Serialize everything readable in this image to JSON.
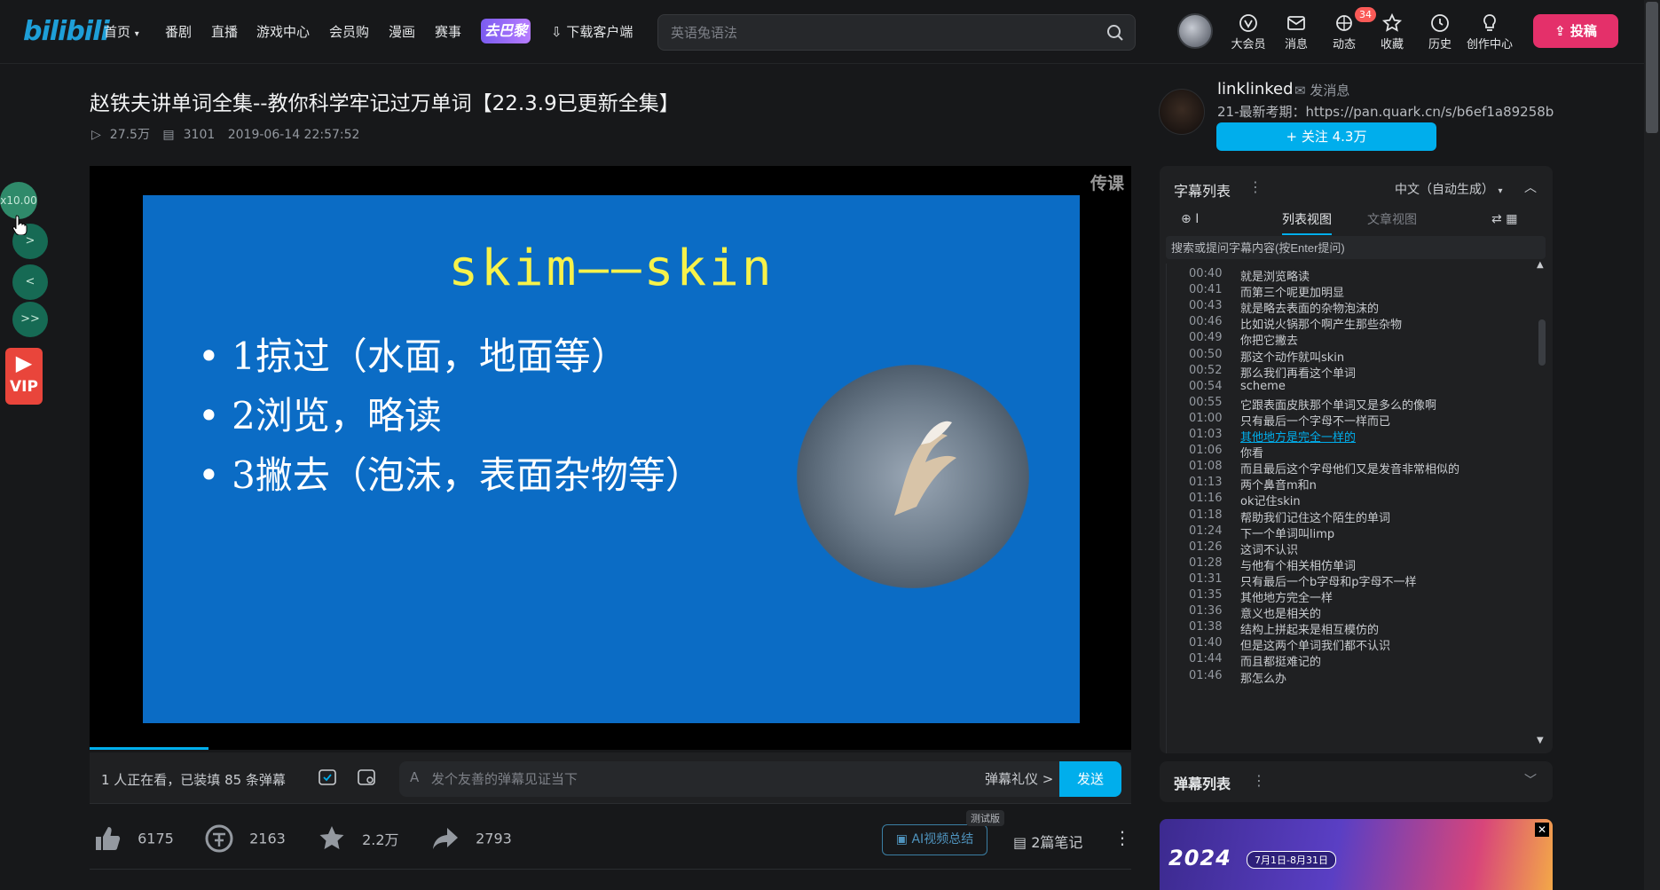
{
  "nav": {
    "logo": "bilibili",
    "items": [
      "首页",
      "番剧",
      "直播",
      "游戏中心",
      "会员购",
      "漫画",
      "赛事"
    ],
    "game_badge": "去巴黎",
    "download_client": "下载客户端",
    "search_placeholder": "英语兔语法",
    "right_items": [
      "大会员",
      "消息",
      "动态",
      "收藏",
      "历史",
      "创作中心"
    ],
    "dynamic_badge": "34",
    "upload_label": "投稿"
  },
  "video": {
    "title": "赵铁夫讲单词全集--教你科学牢记过万单词【22.3.9已更新全集】",
    "views": "27.5万",
    "danmaku_count": "3101",
    "date": "2019-06-14 22:57:52"
  },
  "slide": {
    "title": "skim——skin",
    "bullets": [
      "1掠过（水面，地面等）",
      "2浏览，略读",
      "3撇去（泡沫，表面杂物等）"
    ],
    "watermark": "传课"
  },
  "danmaku_bar": {
    "viewer_text": "1 人正在看，已装填 85 条弹幕",
    "input_placeholder": "发个友善的弹幕见证当下",
    "etiquette": "弹幕礼仪 >",
    "send": "发送"
  },
  "actions": {
    "like": "6175",
    "coin": "2163",
    "favorite": "2.2万",
    "share": "2793",
    "ai_summary": "AI视频总结",
    "ai_beta": "测试版",
    "notes": "2篇笔记",
    "more": "⋮"
  },
  "left_float": {
    "speed": "x10.00",
    "btn_forward": ">",
    "btn_back": "<",
    "btn_fast": ">>",
    "vip": "VIP"
  },
  "uploader": {
    "name": "linklinked",
    "send_message": "发消息",
    "desc": "21-最新考期：https://pan.quark.cn/s/b6ef1a89258b",
    "follow": "+ 关注 4.3万"
  },
  "subtitle_panel": {
    "title": "字幕列表",
    "kebab": "⋮",
    "language": "中文（自动生成）",
    "tab_list": "列表视图",
    "tab_article": "文章视图",
    "search_placeholder": "搜索或提问字幕内容(按Enter提问)",
    "active_index": 10,
    "rows": [
      {
        "time": "00:40",
        "text": "就是浏览略读"
      },
      {
        "time": "00:41",
        "text": "而第三个呢更加明显"
      },
      {
        "time": "00:43",
        "text": "就是略去表面的杂物泡沫的"
      },
      {
        "time": "00:46",
        "text": "比如说火锅那个啊产生那些杂物"
      },
      {
        "time": "00:49",
        "text": "你把它撇去"
      },
      {
        "time": "00:50",
        "text": "那这个动作就叫skin"
      },
      {
        "time": "00:52",
        "text": "那么我们再看这个单词"
      },
      {
        "time": "00:54",
        "text": "scheme"
      },
      {
        "time": "00:55",
        "text": "它跟表面皮肤那个单词又是多么的像啊"
      },
      {
        "time": "01:00",
        "text": "只有最后一个字母不一样而已"
      },
      {
        "time": "01:03",
        "text": "其他地方是完全一样的"
      },
      {
        "time": "01:06",
        "text": "你看"
      },
      {
        "time": "01:08",
        "text": "而且最后这个字母他们又是发音非常相似的"
      },
      {
        "time": "01:13",
        "text": "两个鼻音m和n"
      },
      {
        "time": "01:16",
        "text": "ok记住skin"
      },
      {
        "time": "01:18",
        "text": "帮助我们记住这个陌生的单词"
      },
      {
        "time": "01:24",
        "text": "下一个单词叫limp"
      },
      {
        "time": "01:26",
        "text": "这词不认识"
      },
      {
        "time": "01:28",
        "text": "与他有个相关相仿单词"
      },
      {
        "time": "01:31",
        "text": "只有最后一个b字母和p字母不一样"
      },
      {
        "time": "01:35",
        "text": "其他地方完全一样"
      },
      {
        "time": "01:36",
        "text": "意义也是相关的"
      },
      {
        "time": "01:38",
        "text": "结构上拼起来是相互模仿的"
      },
      {
        "time": "01:40",
        "text": "但是这两个单词我们都不认识"
      },
      {
        "time": "01:44",
        "text": "而且都挺难记的"
      },
      {
        "time": "01:46",
        "text": "那怎么办"
      }
    ]
  },
  "danmaku_list": {
    "title": "弹幕列表",
    "kebab": "⋮"
  },
  "ad": {
    "title": "2024",
    "date": "7月1日-8月31日"
  },
  "colors": {
    "accent": "#00aeec",
    "upload": "#e4306a",
    "slide_bg": "#0b6cc5",
    "slide_title": "#f7f24a"
  }
}
